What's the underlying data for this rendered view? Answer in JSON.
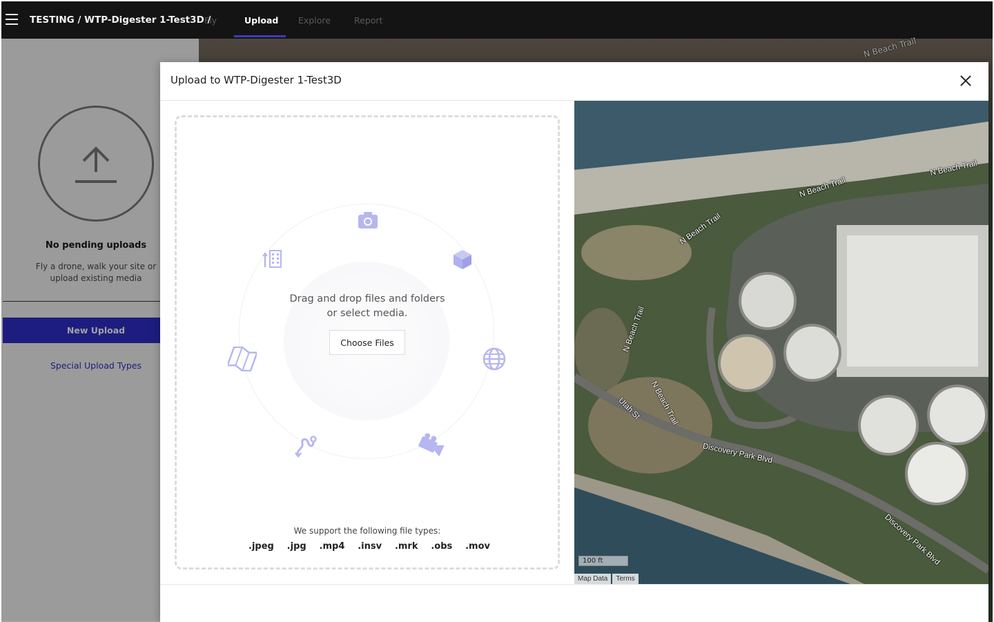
{
  "topbar": {
    "breadcrumb": "TESTING / WTP-Digester 1-Test3D /",
    "tabs": [
      {
        "label": "Fly",
        "active": false
      },
      {
        "label": "Upload",
        "active": true
      },
      {
        "label": "Explore",
        "active": false
      },
      {
        "label": "Report",
        "active": false
      }
    ]
  },
  "sidebar": {
    "empty_title": "No pending uploads",
    "empty_desc_line1": "Fly a drone, walk your site or",
    "empty_desc_line2": "upload existing media",
    "new_upload_label": "New Upload",
    "special_upload_label": "Special Upload Types"
  },
  "modal": {
    "title": "Upload to WTP-Digester 1-Test3D",
    "drag_line1": "Drag and drop files and folders",
    "drag_line2": "or select media.",
    "choose_files_label": "Choose Files",
    "support_text": "We support the following file types:",
    "file_types": [
      ".jpeg",
      ".jpg",
      ".mp4",
      ".insv",
      ".mrk",
      ".obs",
      ".mov"
    ]
  },
  "map": {
    "labels": {
      "beach1": "N Beach Trail",
      "beach2": "N Beach Trail",
      "beach3": "N Beach Trail",
      "beach4": "N Beach Trail",
      "beach5": "N Beach Trail",
      "beach6": "N Beach Trail",
      "utah": "Utah St",
      "discovery1": "Discovery Park Blvd",
      "discovery2": "Discovery Park Blvd"
    },
    "scale": "100 ft",
    "attrib_data": "Map Data",
    "attrib_terms": "Terms"
  },
  "colors": {
    "accent": "#2f2fc9",
    "topbar": "#141414",
    "icon_tint": "#b6b6f0"
  }
}
